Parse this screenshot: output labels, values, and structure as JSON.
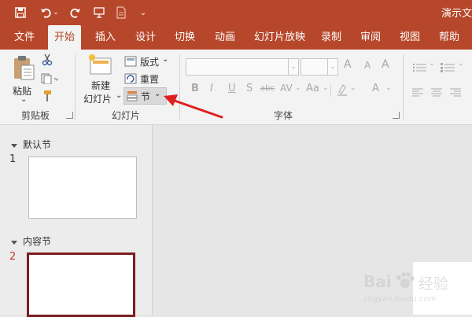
{
  "app": {
    "title_partial": "演示文"
  },
  "quick_access": {
    "save_icon": "save-icon",
    "undo_icon": "undo-icon",
    "redo_icon": "redo-icon",
    "present_icon": "present-from-start-icon",
    "new_icon": "new-document-icon",
    "customize_icon": "customize-toolbar-icon"
  },
  "tabs": [
    {
      "label": "文件",
      "active": false
    },
    {
      "label": "开始",
      "active": true
    },
    {
      "label": "插入",
      "active": false
    },
    {
      "label": "设计",
      "active": false
    },
    {
      "label": "切换",
      "active": false
    },
    {
      "label": "动画",
      "active": false
    },
    {
      "label": "幻灯片放映",
      "active": false
    },
    {
      "label": "录制",
      "active": false
    },
    {
      "label": "审阅",
      "active": false
    },
    {
      "label": "视图",
      "active": false
    },
    {
      "label": "帮助",
      "active": false
    }
  ],
  "ribbon": {
    "clipboard": {
      "group_label": "剪贴板",
      "paste_label": "粘贴",
      "paste_caret": "⌄"
    },
    "slides": {
      "group_label": "幻灯片",
      "new_slide_line1": "新建",
      "new_slide_line2": "幻灯片",
      "new_slide_caret": "⌄",
      "layout_label": "版式",
      "layout_caret": "⌄",
      "reset_label": "重置",
      "section_label": "节",
      "section_caret": "⌄"
    },
    "font": {
      "group_label": "字体",
      "bold": "B",
      "italic": "I",
      "underline": "U",
      "strike": "S",
      "strike_sample": "abc",
      "spacing": "AV",
      "case": "Aa",
      "color": "A",
      "grow": "A",
      "shrink": "A",
      "clear": "A",
      "dropdown_caret": "⌄"
    }
  },
  "slides_panel": {
    "sections": [
      {
        "name": "默认节",
        "slides": [
          {
            "number": "1",
            "selected": false
          }
        ]
      },
      {
        "name": "内容节",
        "slides": [
          {
            "number": "2",
            "selected": true
          }
        ]
      }
    ]
  },
  "watermark": {
    "brand": "Bai",
    "sub": "经验",
    "url": "jingyan.baidu.com"
  },
  "colors": {
    "accent": "#b7472a",
    "selected_slide_border": "#7a1f1f",
    "arrow": "#e02020"
  }
}
